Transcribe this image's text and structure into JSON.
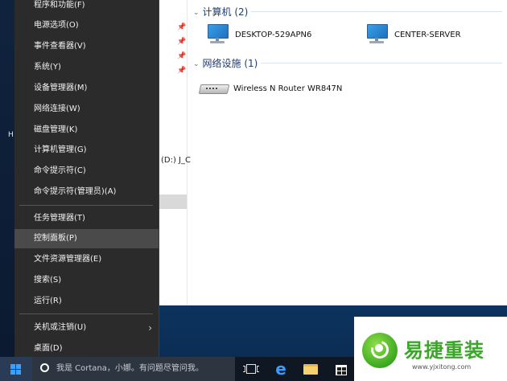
{
  "menu": {
    "items": [
      {
        "label": "程序和功能(F)"
      },
      {
        "label": "电源选项(O)"
      },
      {
        "label": "事件查看器(V)"
      },
      {
        "label": "系统(Y)"
      },
      {
        "label": "设备管理器(M)"
      },
      {
        "label": "网络连接(W)"
      },
      {
        "label": "磁盘管理(K)"
      },
      {
        "label": "计算机管理(G)"
      },
      {
        "label": "命令提示符(C)"
      },
      {
        "label": "命令提示符(管理员)(A)"
      },
      {
        "label": "任务管理器(T)"
      },
      {
        "label": "控制面板(P)"
      },
      {
        "label": "文件资源管理器(E)"
      },
      {
        "label": "搜索(S)"
      },
      {
        "label": "运行(R)"
      },
      {
        "label": "关机或注销(U)"
      },
      {
        "label": "桌面(D)"
      }
    ],
    "hovered": "控制面板(P)"
  },
  "explorer": {
    "left_pane_fragment": "(D:) J_C",
    "groups": [
      {
        "header": "计算机 (2)",
        "devices": [
          "DESKTOP-529APN6",
          "CENTER-SERVER"
        ]
      },
      {
        "header": "网络设施 (1)",
        "devices": [
          "Wireless N Router WR847N"
        ]
      }
    ]
  },
  "desktop": {
    "left_letter": "H"
  },
  "taskbar": {
    "search_placeholder": "我是 Cortana，小娜。有问题尽管问我。",
    "icons": [
      "task-view-icon",
      "edge-icon",
      "file-explorer-icon",
      "store-icon"
    ]
  },
  "watermark": {
    "title": "易捷重装",
    "url": "www.yjxitong.com"
  },
  "colors": {
    "menu_bg": "#2b2b2b",
    "menu_hover": "#4a4a4a",
    "accent": "#3aa0ff",
    "watermark_green": "#3ca62a"
  }
}
